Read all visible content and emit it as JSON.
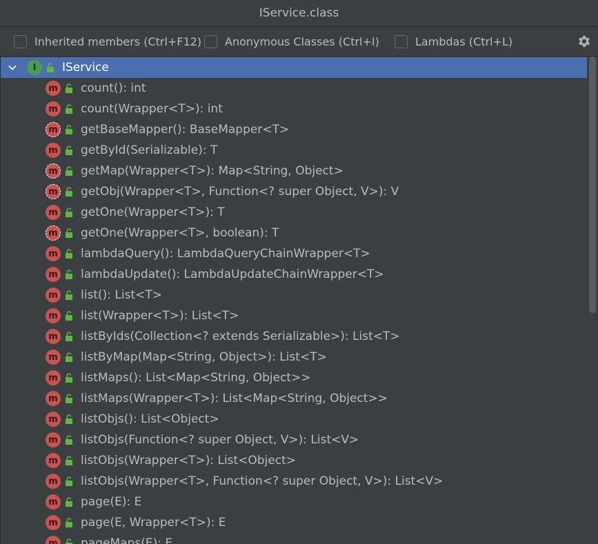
{
  "window": {
    "title": "IService.class"
  },
  "toolbar": {
    "inherited_label": "Inherited members (Ctrl+F12)",
    "anonymous_label": "Anonymous Classes (Ctrl+I)",
    "lambdas_label": "Lambdas (Ctrl+L)",
    "settings_icon": "gear-icon"
  },
  "tree": {
    "root": {
      "label": "IService",
      "badge": "I"
    },
    "items": [
      {
        "label": "count(): int",
        "abstract": false
      },
      {
        "label": "count(Wrapper<T>): int",
        "abstract": false
      },
      {
        "label": "getBaseMapper(): BaseMapper<T>",
        "abstract": true
      },
      {
        "label": "getById(Serializable): T",
        "abstract": false
      },
      {
        "label": "getMap(Wrapper<T>): Map<String, Object>",
        "abstract": true
      },
      {
        "label": "getObj(Wrapper<T>, Function<? super Object, V>): V",
        "abstract": true
      },
      {
        "label": "getOne(Wrapper<T>): T",
        "abstract": false
      },
      {
        "label": "getOne(Wrapper<T>, boolean): T",
        "abstract": true
      },
      {
        "label": "lambdaQuery(): LambdaQueryChainWrapper<T>",
        "abstract": false
      },
      {
        "label": "lambdaUpdate(): LambdaUpdateChainWrapper<T>",
        "abstract": false
      },
      {
        "label": "list(): List<T>",
        "abstract": false
      },
      {
        "label": "list(Wrapper<T>): List<T>",
        "abstract": false
      },
      {
        "label": "listByIds(Collection<? extends Serializable>): List<T>",
        "abstract": false
      },
      {
        "label": "listByMap(Map<String, Object>): List<T>",
        "abstract": false
      },
      {
        "label": "listMaps(): List<Map<String, Object>>",
        "abstract": false
      },
      {
        "label": "listMaps(Wrapper<T>): List<Map<String, Object>>",
        "abstract": false
      },
      {
        "label": "listObjs(): List<Object>",
        "abstract": false
      },
      {
        "label": "listObjs(Function<? super Object, V>): List<V>",
        "abstract": false
      },
      {
        "label": "listObjs(Wrapper<T>): List<Object>",
        "abstract": false
      },
      {
        "label": "listObjs(Wrapper<T>, Function<? super Object, V>): List<V>",
        "abstract": false
      },
      {
        "label": "page(E): E",
        "abstract": false
      },
      {
        "label": "page(E, Wrapper<T>): E",
        "abstract": false
      },
      {
        "label": "pageMaps(E): E",
        "abstract": false
      }
    ],
    "method_badge": "m"
  },
  "colors": {
    "background": "#3c3f41",
    "selection": "#4b6eaf",
    "method_badge": "#c75450",
    "interface_badge": "#499c54",
    "lock": "#62b543"
  }
}
